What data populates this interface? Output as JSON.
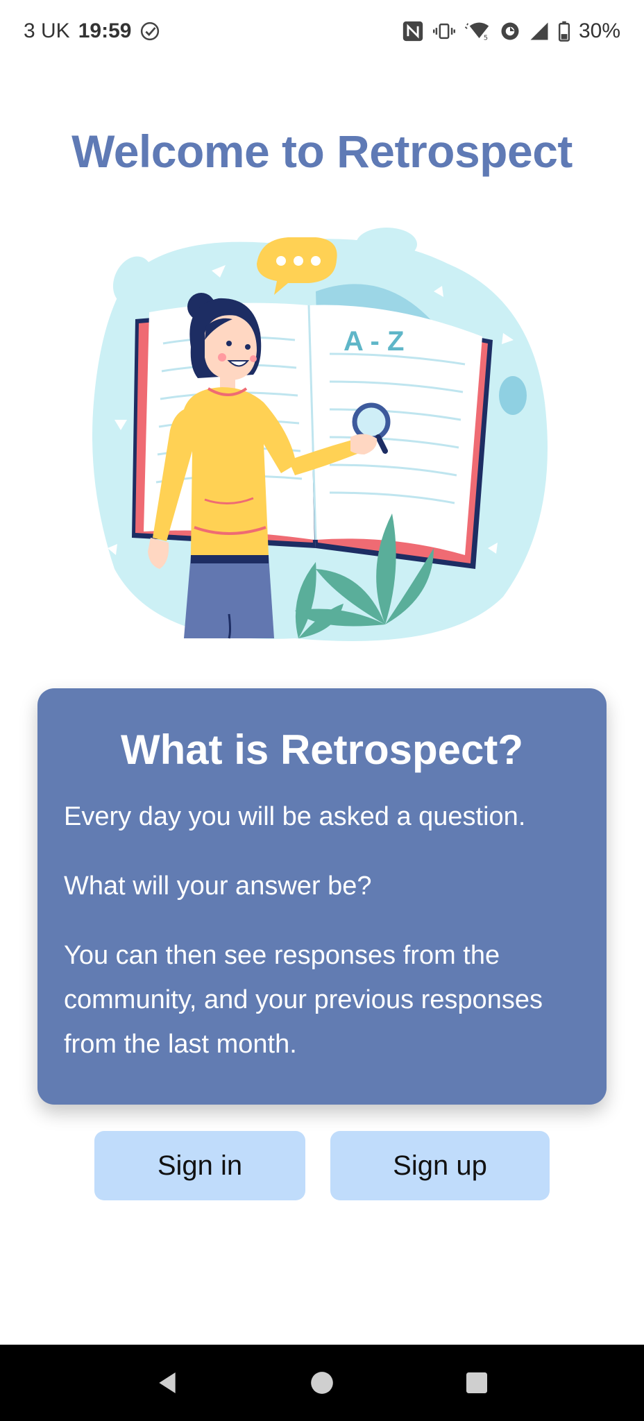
{
  "status_bar": {
    "carrier": "3 UK",
    "time": "19:59",
    "battery": "30%",
    "icons": [
      "check-circle-icon",
      "nfc-icon",
      "vibrate-icon",
      "wifi-icon",
      "data-saver-icon",
      "signal-icon",
      "battery-icon"
    ]
  },
  "header": {
    "title": "Welcome to Retrospect"
  },
  "illustration": {
    "book_text": "A - Z"
  },
  "card": {
    "title": "What is Retrospect?",
    "paragraphs": [
      "Every day you will be asked a question.",
      "What will your answer be?",
      "You can then see responses from the community, and your previous responses from the last month."
    ]
  },
  "actions": {
    "sign_in": "Sign in",
    "sign_up": "Sign up"
  },
  "colors": {
    "accent": "#5f7ab5",
    "card_bg": "#627cb2",
    "button_bg": "#c0dcfb",
    "nav_bg": "#000000"
  },
  "nav": {
    "icons": [
      "back-icon",
      "home-icon",
      "recents-icon"
    ]
  }
}
